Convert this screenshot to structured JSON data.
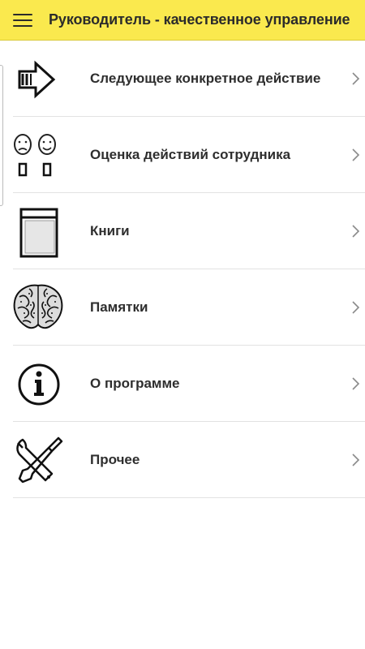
{
  "app_bar": {
    "title": "Руководитель - качественное управление",
    "menu_icon": "hamburger-menu-icon",
    "background_color": "#fae94e"
  },
  "menu": {
    "items": [
      {
        "label": "Следующее конкретное действие",
        "icon": "arrow-right-icon"
      },
      {
        "label": "Оценка действий сотрудника",
        "icon": "faces-rating-icon"
      },
      {
        "label": "Книги",
        "icon": "book-icon"
      },
      {
        "label": "Памятки",
        "icon": "brain-icon"
      },
      {
        "label": "О программе",
        "icon": "info-icon"
      },
      {
        "label": "Прочее",
        "icon": "tools-icon"
      }
    ],
    "chevron_icon": "chevron-right-icon"
  }
}
